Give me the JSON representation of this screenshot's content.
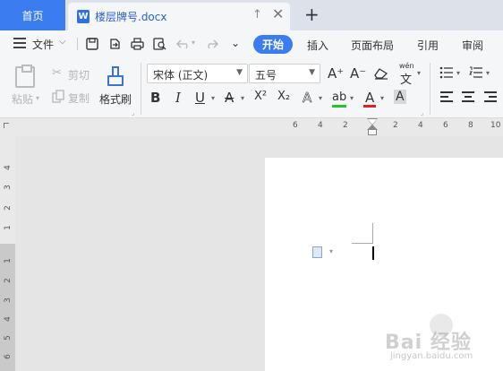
{
  "tabs": {
    "home_label": "首页",
    "doc_icon_letter": "W",
    "doc_title": "楼层牌号.docx",
    "up_icon": "↑",
    "close_icon": "✕",
    "add_icon": "+"
  },
  "menubar": {
    "file_label": "文件",
    "chevron": "⌵",
    "qa_more": "⌄",
    "items": [
      "开始",
      "插入",
      "页面布局",
      "引用",
      "审阅"
    ],
    "active_color": "#3b7cf0"
  },
  "ribbon": {
    "paste_label": "粘贴",
    "cut_label": "剪切",
    "copy_label": "复制",
    "format_painter_label": "格式刷",
    "font_name": "宋体 (正文)",
    "font_size": "五号",
    "grow_font": "A⁺",
    "shrink_font": "A⁻",
    "phonetic_glyph": "wén",
    "phonetic_char": "文",
    "bold": "B",
    "italic": "I",
    "underline": "U",
    "strike": "A",
    "superscript": "X²",
    "subscript": "X₂",
    "text_effect": "A",
    "highlight": "ab",
    "font_color": "A",
    "char_shade": "A",
    "highlight_color": "#2bbf2b",
    "font_color_color": "#e02020"
  },
  "ruler": {
    "h_numbers": [
      "6",
      "4",
      "2",
      "2",
      "4",
      "6",
      "8",
      "10"
    ],
    "v_numbers": [
      "4",
      "3",
      "2",
      "1",
      "1",
      "2",
      "3",
      "4",
      "5",
      "6"
    ]
  },
  "watermark": {
    "brand": "Bai  经验",
    "url": "jingyan.baidu.com"
  }
}
